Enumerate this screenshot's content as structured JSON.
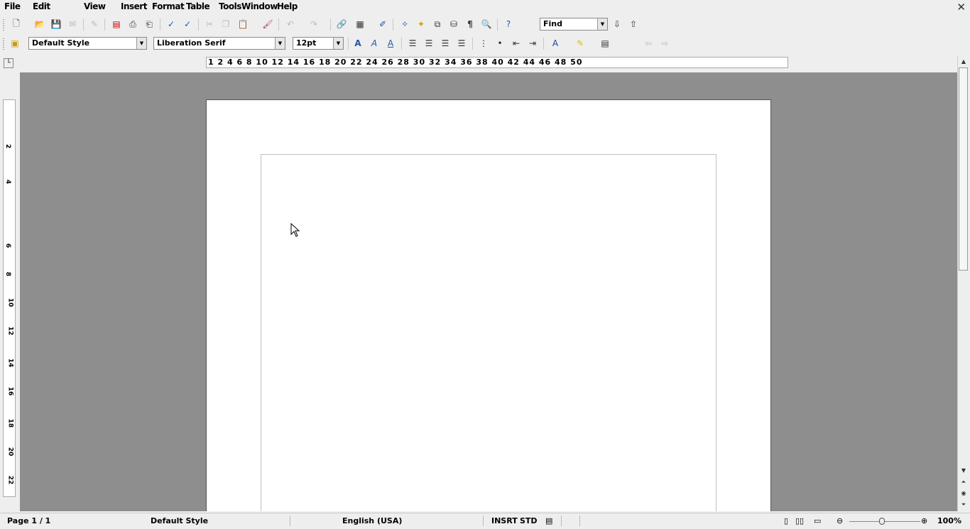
{
  "menubar": {
    "items": [
      "File",
      "Edit",
      "View",
      "Insert",
      "Format",
      "Table",
      "Tools",
      "Window",
      "Help"
    ]
  },
  "toolbar_standard": {
    "icons": [
      "new-icon",
      "open-icon",
      "save-icon",
      "email-icon",
      "edit-file-icon",
      "export-pdf-icon",
      "print-icon",
      "print-preview-icon",
      "spellcheck-icon",
      "autospell-icon",
      "cut-icon",
      "copy-icon",
      "paste-icon",
      "clone-formatting-icon",
      "undo-icon",
      "redo-icon",
      "hyperlink-icon",
      "table-icon",
      "draw-functions-icon",
      "navigator-icon",
      "gallery-icon",
      "data-sources-icon",
      "nonprinting-chars-icon",
      "zoom-icon",
      "help-icon",
      "find-down-icon",
      "find-up-icon"
    ],
    "find_value": "Find"
  },
  "toolbar_formatting": {
    "style_value": "Default Style",
    "font_value": "Liberation Serif",
    "size_value": "12pt",
    "icons": [
      "bold-icon",
      "italic-icon",
      "underline-icon",
      "align-left-icon",
      "align-center-icon",
      "align-right-icon",
      "justify-icon",
      "numbering-icon",
      "bullets-icon",
      "decrease-indent-icon",
      "increase-indent-icon",
      "font-color-icon",
      "highlight-icon",
      "background-color-icon"
    ]
  },
  "ruler": {
    "numbers": "1  2  4  6  8  10  12  14  16  18  20  22  24  26  28  30  32  34  36  38  40  42  44  46  48  50",
    "vertical_numbers": [
      "2",
      "4",
      "6",
      "8",
      "10",
      "12",
      "14",
      "16",
      "18",
      "20",
      "22"
    ]
  },
  "statusbar": {
    "page": "Page 1 / 1",
    "style": "Default Style",
    "language": "English (USA)",
    "mode": "INSRT",
    "selection": "STD",
    "zoom": "100%"
  },
  "colors": {
    "workspace": "#8e8e8e",
    "chrome": "#eeeeee",
    "page": "#ffffff"
  }
}
